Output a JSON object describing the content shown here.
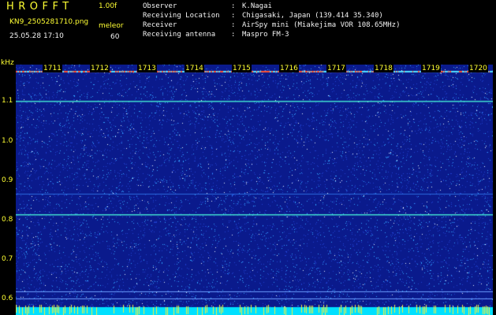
{
  "header": {
    "app_title": "HROFFT",
    "app_version": "1.00f",
    "file_name": "KN9_2505281710.png",
    "date_time": "25.05.28 17:10",
    "unit_label": "meleor",
    "unit_value": "60"
  },
  "info": [
    {
      "label": "Observer",
      "value": "K.Nagai"
    },
    {
      "label": "Receiving Location",
      "value": "Chigasaki, Japan (139.414 35.340)"
    },
    {
      "label": "Receiver",
      "value": "AirSpy mini (Miakejima VOR 108.65MHz)"
    },
    {
      "label": "Receiving antenna",
      "value": "Maspro FM-3"
    }
  ],
  "separator": ":",
  "spectrogram": {
    "y_unit": "kHz",
    "y_ticks": [
      "1.1",
      "1.0",
      "0.9",
      "0.8",
      "0.7",
      "0.6"
    ],
    "time_ticks": [
      "1711",
      "1712",
      "1713",
      "1714",
      "1715",
      "1716",
      "1717",
      "1718",
      "1719",
      "1720"
    ],
    "colors": {
      "background": "#0a1a8c",
      "noise_low": "#2040d0",
      "noise_high": "#30a0ff",
      "carrier": "#40e0d0",
      "bottom_band": "#00e0ff",
      "label": "#ffff33"
    }
  }
}
